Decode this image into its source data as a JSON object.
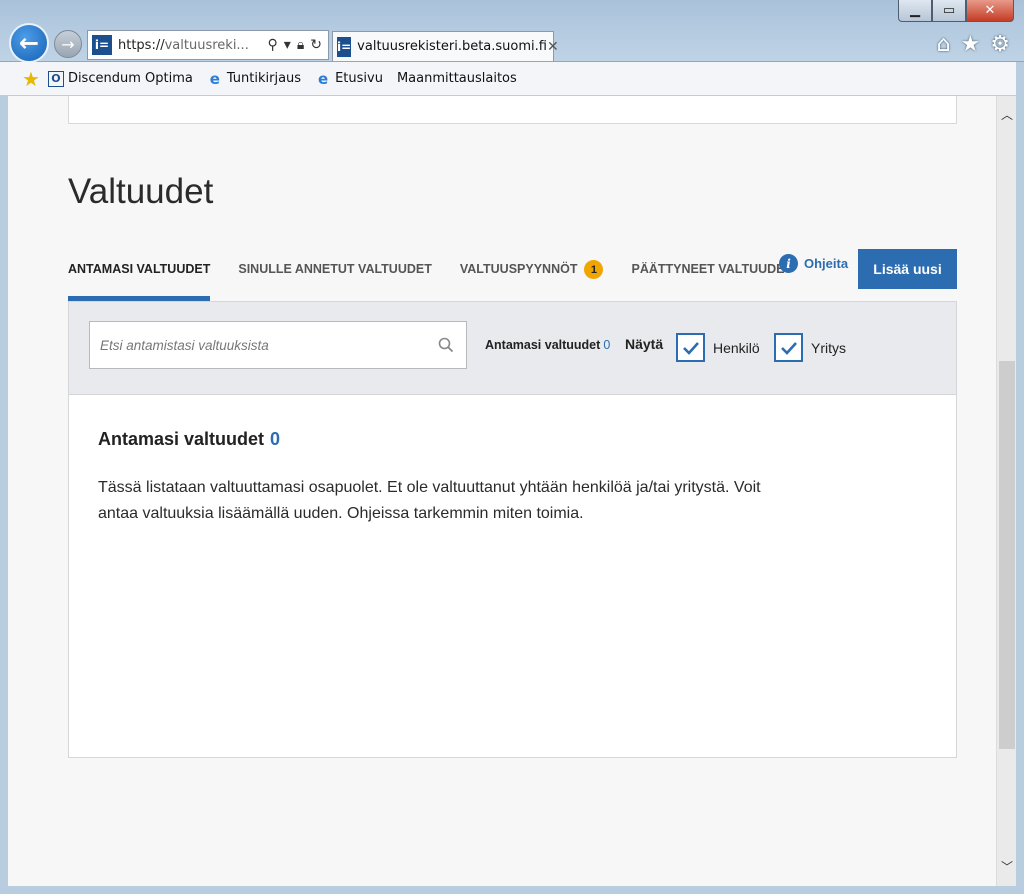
{
  "browser": {
    "url_visible": "https://valtuusreki...",
    "url_host_prefix": "https://",
    "url_rest": "valtuusreki...",
    "tab_title": "valtuusrekisteri.beta.suomi.fi",
    "favorites": [
      {
        "label": "Discendum Optima",
        "icon": "o-icon"
      },
      {
        "label": "Tuntikirjaus",
        "icon": "ie-icon"
      },
      {
        "label": "Etusivu",
        "icon": "ie-icon"
      },
      {
        "label": "Maanmittauslaitos",
        "icon": ""
      }
    ]
  },
  "page": {
    "title": "Valtuudet",
    "tabs": [
      {
        "label": "ANTAMASI VALTUUDET",
        "active": true
      },
      {
        "label": "SINULLE ANNETUT VALTUUDET",
        "active": false
      },
      {
        "label": "VALTUUSPYYNNÖT",
        "active": false,
        "badge": "1"
      },
      {
        "label": "PÄÄTTYNEET VALTUUDET",
        "active": false
      }
    ],
    "help_label": "Ohjeita",
    "add_button": "Lisää uusi"
  },
  "filter": {
    "search_placeholder": "Etsi antamistasi valtuuksista",
    "count_label": "Antamasi valtuudet",
    "count_value": "0",
    "show_label": "Näytä",
    "checkboxes": [
      {
        "label": "Henkilö",
        "checked": true
      },
      {
        "label": "Yritys",
        "checked": true
      }
    ]
  },
  "content": {
    "heading": "Antamasi valtuudet",
    "heading_count": "0",
    "body": "Tässä listataan valtuuttamasi osapuolet. Et ole valtuuttanut yhtään henkilöä ja/tai yritystä. Voit antaa valtuuksia lisäämällä uuden. Ohjeissa tarkemmin miten toimia."
  },
  "colors": {
    "accent": "#2c6cb0",
    "badge": "#f0a500"
  }
}
